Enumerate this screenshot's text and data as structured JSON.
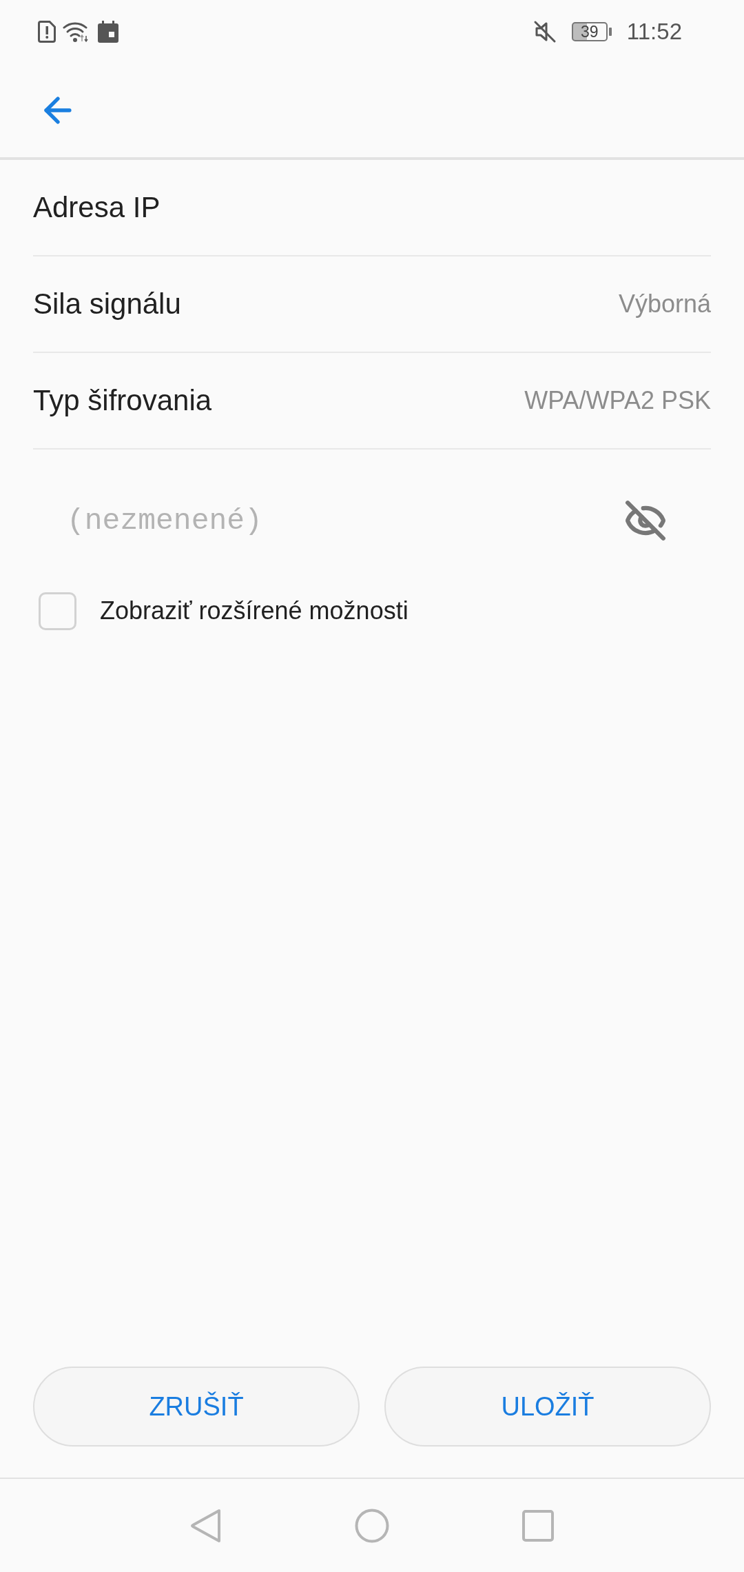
{
  "status_bar": {
    "battery": "39",
    "time": "11:52"
  },
  "details": [
    {
      "label": "Adresa IP"
    },
    {
      "label": "Sila signálu",
      "value": "Výborná"
    },
    {
      "label": "Typ šifrovania",
      "value": "WPA/WPA2 PSK"
    }
  ],
  "password_field": {
    "placeholder": "(nezmenené)",
    "visible": false
  },
  "advanced_option": {
    "label": "Zobraziť rozšírené možnosti",
    "checked": false
  },
  "buttons": [
    {
      "label": "ZRUŠIŤ"
    },
    {
      "label": "ULOŽIŤ"
    }
  ]
}
